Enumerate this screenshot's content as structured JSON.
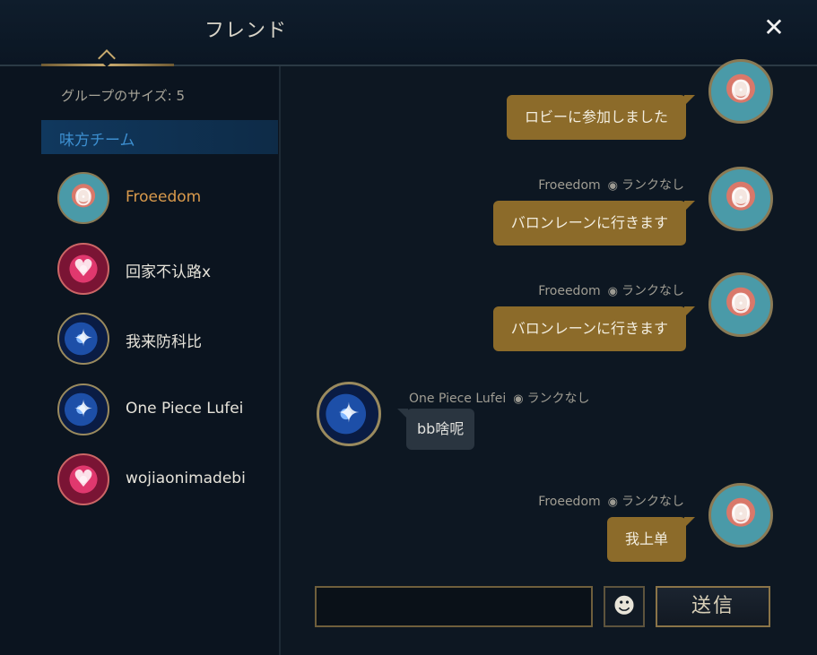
{
  "header": {
    "title": "フレンド",
    "close_label": "✕"
  },
  "sidebar": {
    "group_size": "グループのサイズ: 5",
    "team_label": "味方チーム",
    "members": [
      {
        "name": "Froeedom",
        "avatar_icon": "poro-icon",
        "is_self": true
      },
      {
        "name": "回家不认路x",
        "avatar_icon": "heart-icon",
        "is_self": false
      },
      {
        "name": "我来防科比",
        "avatar_icon": "blue-icon",
        "is_self": false
      },
      {
        "name": "One Piece Lufei",
        "avatar_icon": "blue-icon",
        "is_self": false
      },
      {
        "name": "wojiaonimadebi",
        "avatar_icon": "heart-icon",
        "is_self": false
      }
    ]
  },
  "chat": {
    "messages": [
      {
        "text": "ロビーに参加しました",
        "direction": "out"
      },
      {
        "sender": "Froeedom",
        "rank": "ランクなし",
        "text": "バロンレーンに行きます",
        "direction": "out"
      },
      {
        "sender": "Froeedom",
        "rank": "ランクなし",
        "text": "バロンレーンに行きます",
        "direction": "out"
      },
      {
        "sender": "One Piece Lufei",
        "rank": "ランクなし",
        "text": "bb啥呢",
        "direction": "in"
      },
      {
        "sender": "Froeedom",
        "rank": "ランクなし",
        "text": "我上单",
        "direction": "out"
      }
    ],
    "input_value": "",
    "emoji_label": "☻",
    "send_label": "送信"
  },
  "colors": {
    "accent_gold": "#c8aa6e",
    "bubble_out": "#8c6b2a",
    "bubble_in": "#2a3540",
    "self_name": "#d99a4c",
    "team_blue": "#3d8fd0"
  }
}
